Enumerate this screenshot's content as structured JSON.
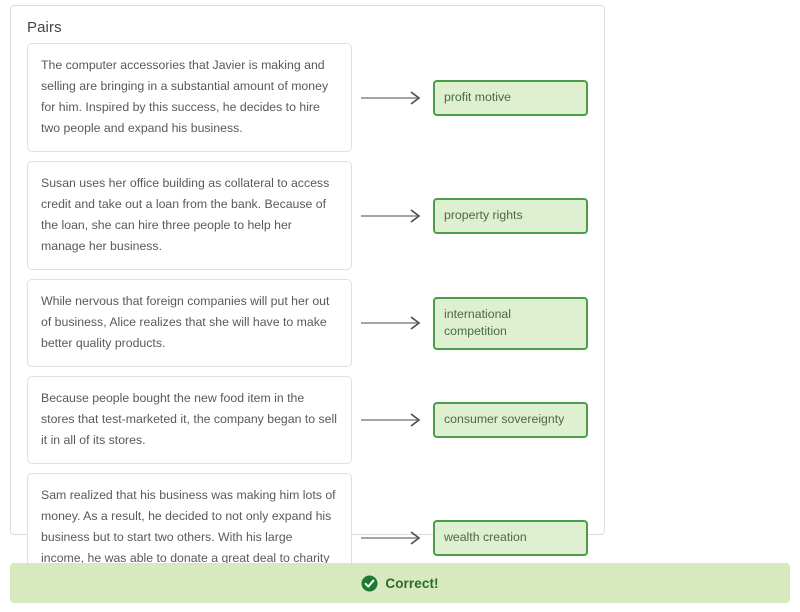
{
  "panel": {
    "title": "Pairs"
  },
  "pairs": [
    {
      "prompt": "The computer accessories that Javier is making and selling are bringing in a substantial amount of money for him. Inspired by this success, he decides to hire two people and expand his business.",
      "answer": "profit motive",
      "connector": "arrow-right-icon"
    },
    {
      "prompt": "Susan uses her office building as collateral to access credit and take out a loan from the bank. Because of the loan, she can hire three people to help her manage her business.",
      "answer": "property rights",
      "connector": "arrow-right-icon"
    },
    {
      "prompt": "While nervous that foreign companies will put her out of business, Alice realizes that she will have to make better quality products.",
      "answer": "international competition",
      "connector": "arrow-right-icon"
    },
    {
      "prompt": "Because people bought the new food item in the stores that test-marketed it, the company began to sell it in all of its stores.",
      "answer": "consumer sovereignty",
      "connector": "arrow-right-icon"
    },
    {
      "prompt": "Sam realized that his business was making him lots of money. As a result, he decided to not only expand his business but to start two others. With his large income, he was able to donate a great deal to charity and to help other people start their businesses.",
      "answer": "wealth creation",
      "connector": "arrow-right-icon"
    }
  ],
  "footer": {
    "status_text": "Correct!",
    "icon": "check-circle-icon",
    "background_color": "#d6e9bf",
    "text_color": "#2d6a2d",
    "icon_color": "#1e7a32"
  },
  "colors": {
    "answer_border": "#4a9e4a",
    "answer_fill": "#dff0d0",
    "answer_text": "#4a6a42",
    "prompt_border": "#e0e0e0",
    "prompt_text": "#58595b",
    "panel_border": "#dcdcdc",
    "arrow": "#6d6e71"
  }
}
